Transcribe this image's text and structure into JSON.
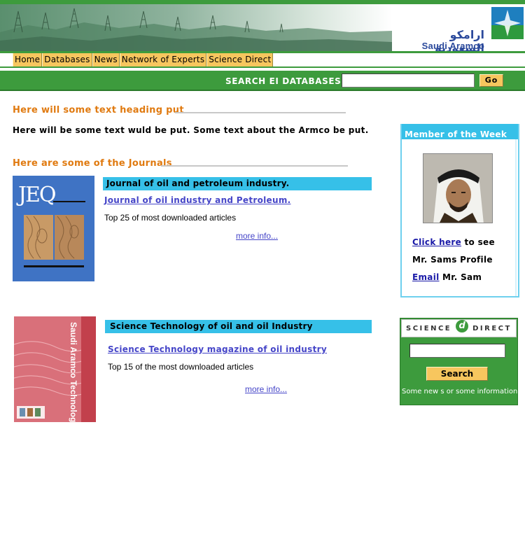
{
  "header": {
    "logo_arabic": "ارامكو السعودية",
    "logo_english": "Saudi Aramco"
  },
  "nav": {
    "items": [
      {
        "label": "Home"
      },
      {
        "label": "Databases"
      },
      {
        "label": "News"
      },
      {
        "label": "Network of Experts"
      },
      {
        "label": "Science Direct"
      }
    ]
  },
  "search": {
    "label": "SEARCH EI DATABASES:",
    "value": "",
    "button": "Go"
  },
  "intro": {
    "heading": "Here will some text heading put",
    "text": "Here will be some text wuld be put.  Some text about the Armco be put."
  },
  "journals": {
    "heading": "Here are some of the Journals",
    "items": [
      {
        "cover_title": "JEQ",
        "title": "Journal of oil and petroleum industry.",
        "link": "Journal of oil industry and Petroleum.",
        "description": "Top 25  of most downloaded articles",
        "more": "more info..."
      },
      {
        "cover_title": "Saudi Aramco Technology",
        "title": "Science Technology of oil and oil Industry",
        "link": "Science Technology magazine of oil industry",
        "description": "Top 15 of the most downloaded articles",
        "more": "more info..."
      }
    ]
  },
  "member": {
    "title": "Member of the Week",
    "click_here": "Click here",
    "to_see": " to see",
    "profile": "Mr. Sams Profile",
    "email": "Email",
    "email_name": " Mr. Sam"
  },
  "science_direct": {
    "logo_left": "SCIENCE",
    "logo_mark": "d",
    "logo_right": "DIRECT",
    "input_value": "",
    "button": "Search",
    "news": "Some new s or some information"
  },
  "colors": {
    "green": "#3d9b3d",
    "nav_tab": "#f7c65e",
    "heading_orange": "#e07a10",
    "title_bar_blue": "#36c0e8",
    "link_blue": "#4545c8"
  }
}
